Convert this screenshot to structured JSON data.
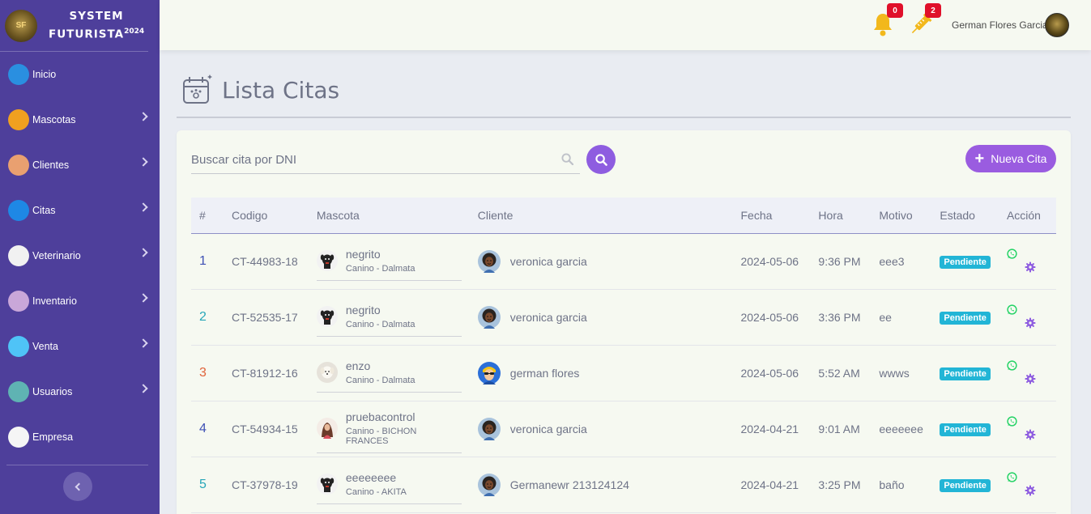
{
  "brand": {
    "logo_text": "SF",
    "line1": "SYSTEM",
    "line2": "FUTURISTA",
    "year": "2024"
  },
  "sidebar": {
    "items": [
      {
        "label": "Inicio",
        "icon": "monitor-icon",
        "color": "#2a8fe0",
        "chevron": false
      },
      {
        "label": "Mascotas",
        "icon": "paw-icon",
        "color": "#f0a020",
        "chevron": true
      },
      {
        "label": "Clientes",
        "icon": "people-icon",
        "color": "#e9a070",
        "chevron": true
      },
      {
        "label": "Citas",
        "icon": "calendar-icon",
        "color": "#1e88e5",
        "chevron": true
      },
      {
        "label": "Veterinario",
        "icon": "doctor-icon",
        "color": "#f1f1f1",
        "chevron": true
      },
      {
        "label": "Inventario",
        "icon": "box-icon",
        "color": "#c9a7d9",
        "chevron": true
      },
      {
        "label": "Venta",
        "icon": "cash-register-icon",
        "color": "#4fc3f7",
        "chevron": true
      },
      {
        "label": "Usuarios",
        "icon": "user-icon",
        "color": "#5fb3b3",
        "chevron": true
      },
      {
        "label": "Empresa",
        "icon": "house-icon",
        "color": "#f5f5f5",
        "chevron": false
      }
    ]
  },
  "topbar": {
    "notifications_count": "0",
    "vaccine_count": "2",
    "username": "German Flores Garcia"
  },
  "page": {
    "title": "Lista Citas"
  },
  "search": {
    "placeholder": "Buscar cita por DNI"
  },
  "new_button": {
    "label": "Nueva Cita"
  },
  "table": {
    "headers": [
      "#",
      "Codigo",
      "Mascota",
      "Cliente",
      "Fecha",
      "Hora",
      "Motivo",
      "Estado",
      "Acción"
    ],
    "rows": [
      {
        "num": "1",
        "num_color": "#3f51b5",
        "code": "CT-44983-18",
        "pet": "negrito",
        "breed": "Canino - Dalmata",
        "pet_avatar": "black-dog",
        "client": "veronica garcia",
        "client_avatar": "afro",
        "date": "2024-05-06",
        "time": "9:36 PM",
        "reason": "eee3",
        "status": "Pendiente"
      },
      {
        "num": "2",
        "num_color": "#26a6b8",
        "code": "CT-52535-17",
        "pet": "negrito",
        "breed": "Canino - Dalmata",
        "pet_avatar": "black-dog",
        "client": "veronica garcia",
        "client_avatar": "afro",
        "date": "2024-05-06",
        "time": "3:36 PM",
        "reason": "ee",
        "status": "Pendiente"
      },
      {
        "num": "3",
        "num_color": "#e0633a",
        "code": "CT-81912-16",
        "pet": "enzo",
        "breed": "Canino - Dalmata",
        "pet_avatar": "white-dog",
        "client": "german flores",
        "client_avatar": "sunglasses",
        "date": "2024-05-06",
        "time": "5:52 AM",
        "reason": "wwws",
        "status": "Pendiente"
      },
      {
        "num": "4",
        "num_color": "#3f51b5",
        "code": "CT-54934-15",
        "pet": "pruebacontrol",
        "breed": "Canino - BICHON FRANCES",
        "pet_avatar": "woman",
        "client": "veronica garcia",
        "client_avatar": "afro",
        "date": "2024-04-21",
        "time": "9:01 AM",
        "reason": "eeeeeee",
        "status": "Pendiente"
      },
      {
        "num": "5",
        "num_color": "#26a6b8",
        "code": "CT-37978-19",
        "pet": "eeeeeeee",
        "breed": "Canino - AKITA",
        "pet_avatar": "black-dog",
        "client": "Germanewr 213124124",
        "client_avatar": "afro",
        "date": "2024-04-21",
        "time": "3:25 PM",
        "reason": "baño",
        "status": "Pendiente"
      }
    ]
  },
  "colors": {
    "sidebar": "#4e3f9b",
    "accent": "#9a5ce0",
    "status": "#22b5d6",
    "whatsapp": "#25d366",
    "gear": "#8e5de0"
  }
}
